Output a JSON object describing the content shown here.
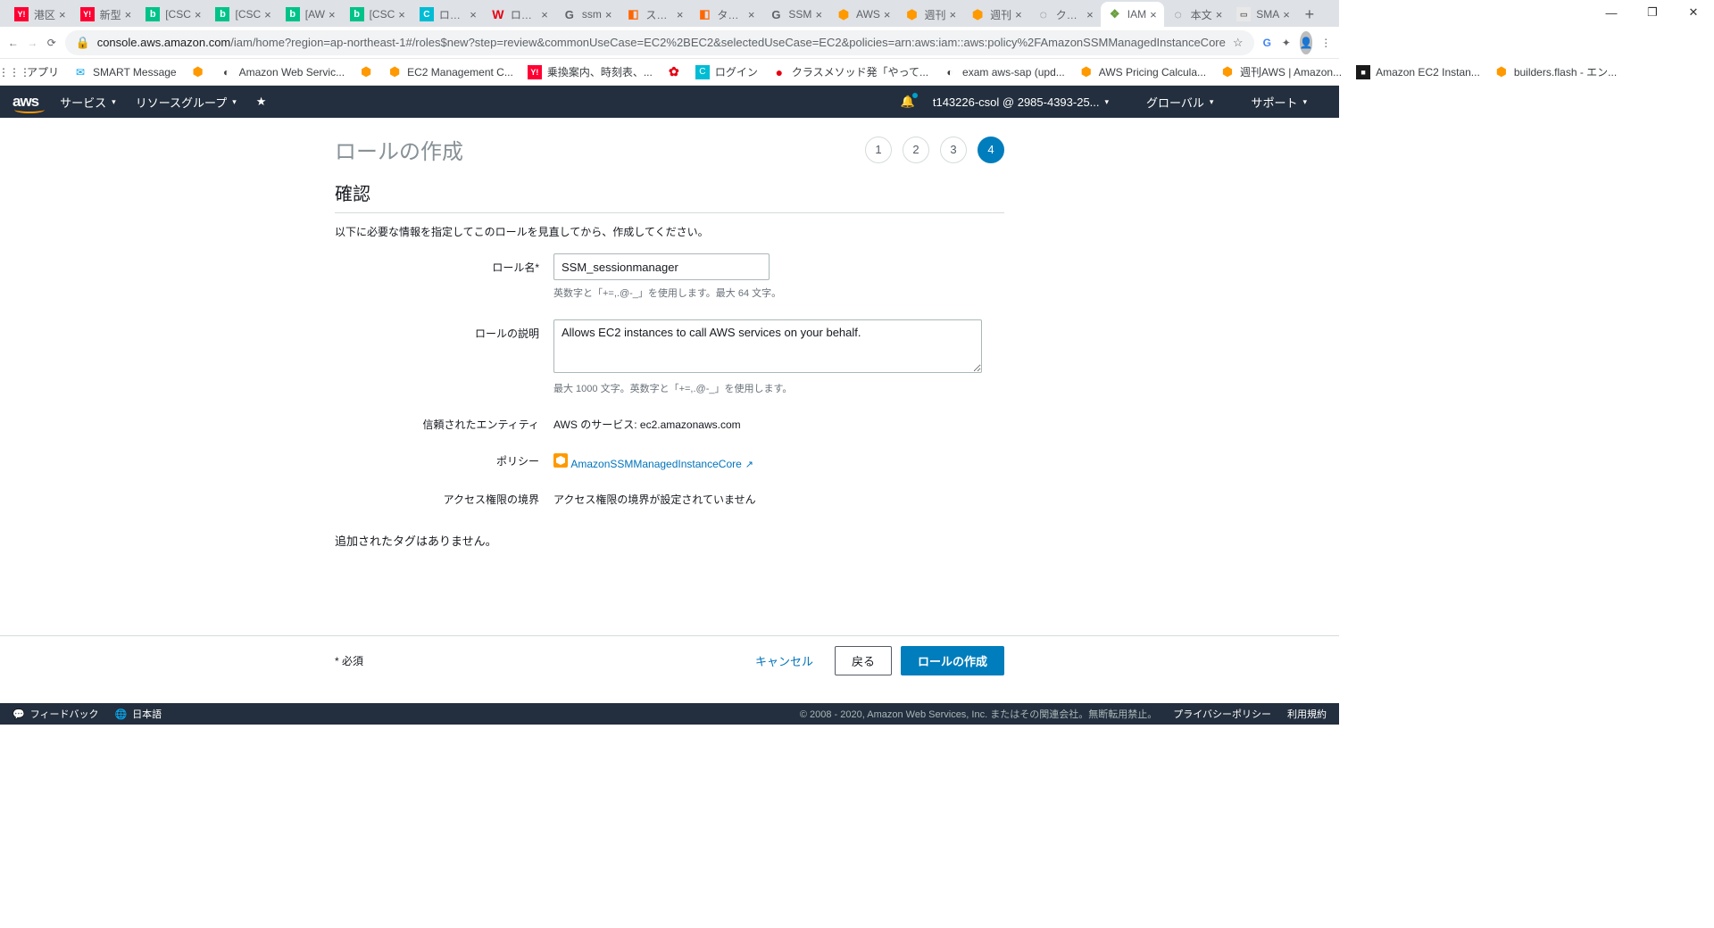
{
  "window": {
    "minimize": "—",
    "maximize": "❐",
    "close": "✕"
  },
  "tabs": [
    {
      "title": "港区",
      "icon": "Y!",
      "cls": "ico-yahoo"
    },
    {
      "title": "新型",
      "icon": "Y!",
      "cls": "ico-yahoo"
    },
    {
      "title": "[CSC",
      "icon": "b",
      "cls": "ico-green"
    },
    {
      "title": "[CSC",
      "icon": "b",
      "cls": "ico-green"
    },
    {
      "title": "[AW",
      "icon": "b",
      "cls": "ico-green"
    },
    {
      "title": "[CSC",
      "icon": "b",
      "cls": "ico-green"
    },
    {
      "title": "ログイ",
      "icon": "C",
      "cls": "ico-cyan"
    },
    {
      "title": "ログイ",
      "icon": "W",
      "cls": "ico-red"
    },
    {
      "title": "ssm",
      "icon": "G",
      "cls": "ico-google"
    },
    {
      "title": "ステッ",
      "icon": "◧",
      "cls": "ico-bri"
    },
    {
      "title": "タスク",
      "icon": "◧",
      "cls": "ico-bri"
    },
    {
      "title": "SSM",
      "icon": "G",
      "cls": "ico-google"
    },
    {
      "title": "AWS",
      "icon": "⬢",
      "cls": "ico-orange"
    },
    {
      "title": "週刊",
      "icon": "⬢",
      "cls": "ico-orange"
    },
    {
      "title": "週刊",
      "icon": "⬢",
      "cls": "ico-orange"
    },
    {
      "title": "クラウ",
      "icon": "◌",
      "cls": "ico-chrome"
    },
    {
      "title": "IAM",
      "icon": "❖",
      "cls": "ico-key",
      "active": true
    },
    {
      "title": "本文",
      "icon": "◌",
      "cls": "ico-chrome"
    },
    {
      "title": "SMA",
      "icon": "▭",
      "cls": "ico-sma"
    }
  ],
  "url": {
    "lock": "🔒",
    "host": "console.aws.amazon.com",
    "path": "/iam/home?region=ap-northeast-1#/roles$new?step=review&commonUseCase=EC2%2BEC2&selectedUseCase=EC2&policies=arn:aws:iam::aws:policy%2FAmazonSSMManagedInstanceCore",
    "star": "☆"
  },
  "extensions": {
    "translate": "G",
    "puzzle": "✦",
    "avatar": "👤",
    "menu": "⋮"
  },
  "bookmarks": [
    {
      "icon": "⋮⋮⋮",
      "label": "アプリ",
      "cls": ""
    },
    {
      "icon": "✉",
      "label": "SMART Message",
      "cls": "ico-cm"
    },
    {
      "icon": "⬢",
      "label": "",
      "cls": "ico-orange"
    },
    {
      "icon": "◐",
      "label": "Amazon Web Servic...",
      "cls": ""
    },
    {
      "icon": "⬢",
      "label": "",
      "cls": "ico-orange"
    },
    {
      "icon": "⬢",
      "label": "EC2 Management C...",
      "cls": "ico-orange"
    },
    {
      "icon": "Y!",
      "label": "乗換案内、時刻表、...",
      "cls": "ico-yahoo"
    },
    {
      "icon": "✿",
      "label": "",
      "cls": "ico-red"
    },
    {
      "icon": "C",
      "label": "ログイン",
      "cls": "ico-cyan"
    },
    {
      "icon": "●",
      "label": "クラスメソッド発「やって...",
      "cls": "ico-red"
    },
    {
      "icon": "◐",
      "label": "exam aws-sap (upd...",
      "cls": ""
    },
    {
      "icon": "⬢",
      "label": "AWS Pricing Calcula...",
      "cls": "ico-orange"
    },
    {
      "icon": "⬢",
      "label": "週刊AWS | Amazon...",
      "cls": "ico-orange"
    },
    {
      "icon": "■",
      "label": "Amazon EC2 Instan...",
      "cls": "ico-black"
    },
    {
      "icon": "⬢",
      "label": "builders.flash - エン...",
      "cls": "ico-orange"
    }
  ],
  "awsHeader": {
    "logo": "aws",
    "services": "サービス",
    "resourceGroups": "リソースグループ",
    "pin": "★",
    "bell": "🔔",
    "account": "t143226-csol @ 2985-4393-25...",
    "region": "グローバル",
    "support": "サポート"
  },
  "page": {
    "title": "ロールの作成",
    "steps": [
      "1",
      "2",
      "3",
      "4"
    ],
    "activeStep": 4,
    "section": "確認",
    "instruction": "以下に必要な情報を指定してこのロールを見直してから、作成してください。",
    "roleNameLabel": "ロール名*",
    "roleNameValue": "SSM_sessionmanager",
    "roleNameHint": "英数字と「+=,.@-_」を使用します。最大 64 文字。",
    "roleDescLabel": "ロールの説明",
    "roleDescValue": "Allows EC2 instances to call AWS services on your behalf.",
    "roleDescHint": "最大 1000 文字。英数字と「+=,.@-_」を使用します。",
    "trustedLabel": "信頼されたエンティティ",
    "trustedValue": "AWS のサービス: ec2.amazonaws.com",
    "policyLabel": "ポリシー",
    "policyValue": "AmazonSSMManagedInstanceCore",
    "boundaryLabel": "アクセス権限の境界",
    "boundaryValue": "アクセス権限の境界が設定されていません",
    "noTags": "追加されたタグはありません。",
    "required": "* 必須",
    "cancel": "キャンセル",
    "back": "戻る",
    "create": "ロールの作成"
  },
  "footer": {
    "feedback": "フィードバック",
    "lang": "日本語",
    "copyright": "© 2008 - 2020, Amazon Web Services, Inc. またはその関連会社。無断転用禁止。",
    "privacy": "プライバシーポリシー",
    "terms": "利用規約"
  }
}
